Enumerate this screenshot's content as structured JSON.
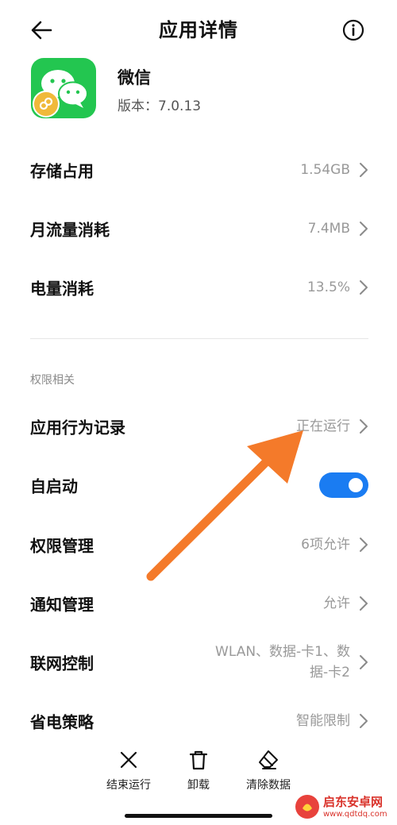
{
  "header": {
    "title": "应用详情"
  },
  "app": {
    "name": "微信",
    "version": "版本：7.0.13"
  },
  "details": [
    {
      "label": "存储占用",
      "value": "1.54GB"
    },
    {
      "label": "月流量消耗",
      "value": "7.4MB"
    },
    {
      "label": "电量消耗",
      "value": "13.5%"
    }
  ],
  "permissions": {
    "section_title": "权限相关",
    "behavior_log": {
      "label": "应用行为记录",
      "value": "正在运行"
    },
    "autostart": {
      "label": "自启动",
      "enabled": true
    },
    "permission_mgmt": {
      "label": "权限管理",
      "value": "6项允许"
    },
    "notification_mgmt": {
      "label": "通知管理",
      "value": "允许"
    },
    "network_control": {
      "label": "联网控制",
      "value_line1": "WLAN、数据-卡1、数",
      "value_line2": "据-卡2"
    },
    "power_saving": {
      "label": "省电策略",
      "value": "智能限制"
    }
  },
  "bottom_actions": [
    {
      "label": "结束运行",
      "icon": "close-icon"
    },
    {
      "label": "卸载",
      "icon": "trash-icon"
    },
    {
      "label": "清除数据",
      "icon": "eraser-icon"
    }
  ],
  "watermark": {
    "name": "启东安卓网",
    "url": "www.qdtdq.com"
  },
  "colors": {
    "accent": "#1a7cf2",
    "annotation_arrow": "#f47a2a",
    "wechat_green": "#23c650"
  }
}
